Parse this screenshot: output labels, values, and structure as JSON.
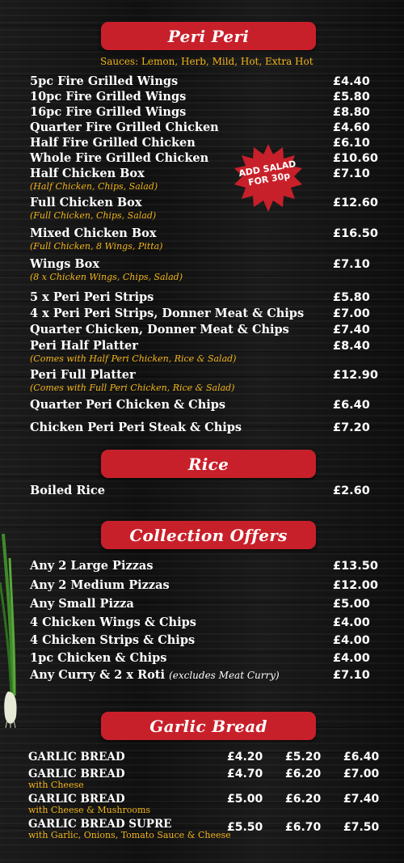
{
  "peri": {
    "title": "Peri Peri",
    "sauces": "Sauces: Lemon, Herb, Mild, Hot, Extra Hot",
    "badge": {
      "line1": "ADD SALAD",
      "line2": "FOR 30p"
    },
    "items": [
      {
        "name": "5pc Fire Grilled Wings",
        "price": "£4.40"
      },
      {
        "name": "10pc Fire Grilled Wings",
        "price": "£5.80"
      },
      {
        "name": "16pc Fire Grilled Wings",
        "price": "£8.80"
      },
      {
        "name": "Quarter Fire Grilled Chicken",
        "price": "£4.60"
      },
      {
        "name": "Half Fire Grilled Chicken",
        "price": "£6.10"
      },
      {
        "name": "Whole Fire Grilled Chicken",
        "price": "£10.60"
      },
      {
        "name": "Half Chicken Box",
        "desc": "(Half Chicken, Chips, Salad)",
        "price": "£7.10"
      },
      {
        "name": "Full Chicken Box",
        "desc": "(Full Chicken, Chips, Salad)",
        "price": "£12.60"
      },
      {
        "name": "Mixed Chicken Box",
        "desc": "(Full Chicken, 8 Wings, Pitta)",
        "price": "£16.50"
      },
      {
        "name": "Wings Box",
        "desc": "(8 x Chicken Wings, Chips, Salad)",
        "price": "£7.10"
      },
      {
        "name": "5 x Peri Peri Strips",
        "price": "£5.80"
      },
      {
        "name": "4 x Peri Peri Strips, Donner Meat & Chips",
        "price": "£7.00"
      },
      {
        "name": "Quarter Chicken, Donner Meat & Chips",
        "price": "£7.40"
      },
      {
        "name": "Peri Half Platter",
        "desc": "(Comes with Half Peri Chicken, Rice & Salad)",
        "price": "£8.40"
      },
      {
        "name": "Peri Full Platter",
        "desc": "(Comes with Full Peri Chicken, Rice & Salad)",
        "price": "£12.90"
      },
      {
        "name": "Quarter Peri Chicken & Chips",
        "price": "£6.40"
      },
      {
        "name": "Chicken Peri Peri Steak & Chips",
        "price": "£7.20"
      }
    ]
  },
  "rice": {
    "title": "Rice",
    "items": [
      {
        "name": "Boiled Rice",
        "price": "£2.60"
      }
    ]
  },
  "offers": {
    "title": "Collection Offers",
    "items": [
      {
        "name": "Any 2 Large Pizzas",
        "price": "£13.50"
      },
      {
        "name": "Any 2 Medium Pizzas",
        "price": "£12.00"
      },
      {
        "name": "Any Small Pizza",
        "price": "£5.00"
      },
      {
        "name": "4 Chicken Wings & Chips",
        "price": "£4.00"
      },
      {
        "name": "4 Chicken Strips & Chips",
        "price": "£4.00"
      },
      {
        "name": "1pc Chicken & Chips",
        "price": "£4.00"
      },
      {
        "name": "Any Curry & 2 x Roti",
        "note": "(excludes Meat Curry)",
        "price": "£7.10"
      }
    ]
  },
  "garlic": {
    "title": "Garlic Bread",
    "items": [
      {
        "name": "GARLIC BREAD",
        "prices": [
          "£4.20",
          "£5.20",
          "£6.40"
        ]
      },
      {
        "name": "GARLIC BREAD",
        "desc": "with Cheese",
        "prices": [
          "£4.70",
          "£6.20",
          "£7.00"
        ]
      },
      {
        "name": "GARLIC BREAD",
        "desc": "with Cheese & Mushrooms",
        "prices": [
          "£5.00",
          "£6.20",
          "£7.40"
        ]
      },
      {
        "name": "GARLIC BREAD SUPRE",
        "desc": "with Garlic, Onions, Tomato Sauce & Cheese",
        "prices": [
          "£5.50",
          "£6.70",
          "£7.50"
        ]
      }
    ]
  },
  "colors": {
    "banner": "#c8202a",
    "accent": "#f3b61a",
    "background": "#141414"
  }
}
